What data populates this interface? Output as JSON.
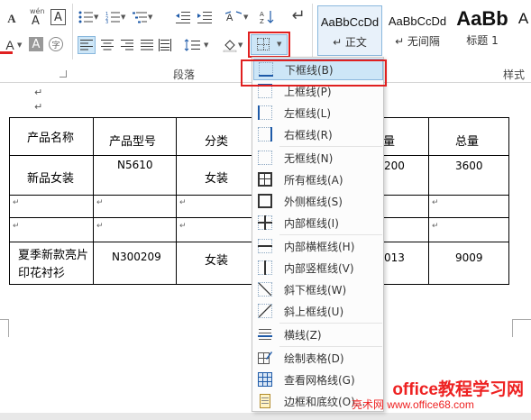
{
  "ribbon": {
    "font_group": {
      "font_color_icon": "font-color-icon",
      "highlight_icon": "highlight-icon",
      "text_border_icon": "char-border-icon",
      "phonetic_label": "wén",
      "phonetic_char": "A",
      "border_char": "A",
      "enclose_char": "字"
    },
    "paragraph_group_label": "段落",
    "styles_group_label": "样式",
    "styles": [
      {
        "sample": "AaBbCcDd",
        "name": "↵ 正文"
      },
      {
        "sample": "AaBbCcDd",
        "name": "↵ 无间隔"
      },
      {
        "sample": "AaBb",
        "name": "标题 1"
      },
      {
        "sample": "A",
        "name": ""
      }
    ]
  },
  "document": {
    "table": {
      "headers": [
        "产品名称",
        "产品型号",
        "分类",
        "",
        "量",
        "总量"
      ],
      "rows": [
        [
          "新品女装",
          "N5610",
          "女装",
          "",
          "200",
          "3600"
        ],
        [
          "",
          "",
          "",
          "",
          "",
          ""
        ],
        [
          "",
          "",
          "",
          "",
          "",
          ""
        ],
        [
          "夏季新款亮片印花衬衫",
          "N300209",
          "女装",
          "",
          "013",
          "9009"
        ]
      ]
    },
    "paragraph_mark": "↵"
  },
  "border_menu": {
    "items": [
      {
        "label": "下框线(B)",
        "icon": "bottom-border-icon",
        "active": true
      },
      {
        "label": "上框线(P)",
        "icon": "top-border-icon"
      },
      {
        "label": "左框线(L)",
        "icon": "left-border-icon"
      },
      {
        "label": "右框线(R)",
        "icon": "right-border-icon"
      },
      {
        "label": "无框线(N)",
        "icon": "no-border-icon"
      },
      {
        "label": "所有框线(A)",
        "icon": "all-borders-icon"
      },
      {
        "label": "外侧框线(S)",
        "icon": "outside-borders-icon"
      },
      {
        "label": "内部框线(I)",
        "icon": "inside-borders-icon"
      },
      {
        "label": "内部横框线(H)",
        "icon": "inside-horizontal-border-icon"
      },
      {
        "label": "内部竖框线(V)",
        "icon": "inside-vertical-border-icon"
      },
      {
        "label": "斜下框线(W)",
        "icon": "diagonal-down-border-icon"
      },
      {
        "label": "斜上框线(U)",
        "icon": "diagonal-up-border-icon"
      },
      {
        "label": "横线(Z)",
        "icon": "horizontal-line-icon"
      },
      {
        "label": "绘制表格(D)",
        "icon": "draw-table-icon"
      },
      {
        "label": "查看网格线(G)",
        "icon": "view-gridlines-icon"
      },
      {
        "label": "边框和底纹(O)...",
        "icon": "borders-shading-icon"
      }
    ]
  },
  "watermark": {
    "line1": "office教程学习网",
    "line2": "亮术网 www.office68.com"
  },
  "colors": {
    "accent": "#1e5aa8",
    "highlight_frame": "#e02020",
    "menu_active_bg": "#cde6f7"
  }
}
